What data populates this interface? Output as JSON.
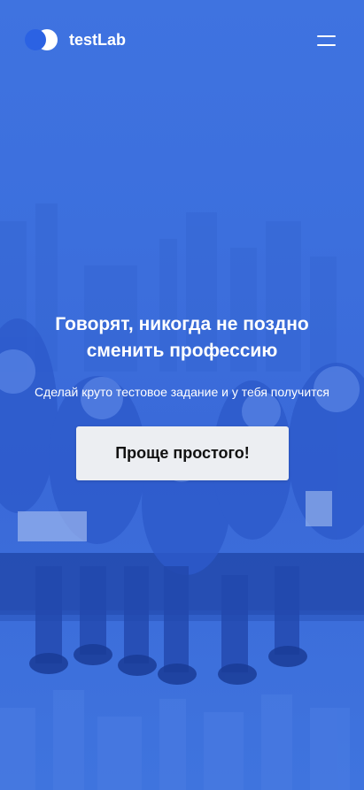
{
  "header": {
    "brand_name": "testLab",
    "logo_icon": "two-circles-logo",
    "menu_icon": "hamburger-menu-icon"
  },
  "hero": {
    "headline_line1": "Говорят, никогда не поздно",
    "headline_line2": "сменить профессию",
    "subtitle": "Сделай круто тестовое задание и у тебя получится",
    "cta_label": "Проще простого!",
    "background_image": "workers-sitting-on-beam-photo"
  },
  "colors": {
    "overlay_blue": "#3c6fdd",
    "logo_blue": "#2b62e3",
    "text": "#ffffff",
    "button_bg": "#eceef2",
    "button_text": "#111111"
  }
}
